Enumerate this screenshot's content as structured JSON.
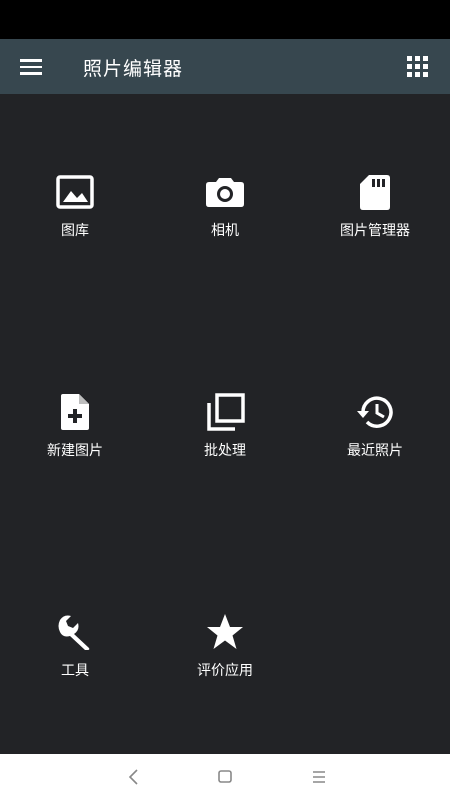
{
  "app_bar": {
    "title": "照片编辑器",
    "menu_icon": "hamburger-menu-icon",
    "apps_icon": "grid-apps-icon",
    "color": "#37474f"
  },
  "tiles": [
    {
      "label": "图库",
      "icon": "gallery-image-icon"
    },
    {
      "label": "相机",
      "icon": "camera-icon"
    },
    {
      "label": "图片管理器",
      "icon": "sd-card-icon"
    },
    {
      "label": "新建图片",
      "icon": "new-document-icon"
    },
    {
      "label": "批处理",
      "icon": "batch-layers-icon"
    },
    {
      "label": "最近照片",
      "icon": "history-icon"
    },
    {
      "label": "工具",
      "icon": "wrench-icon"
    },
    {
      "label": "评价应用",
      "icon": "star-icon"
    }
  ],
  "nav_bar": {
    "back_icon": "back-chevron-icon",
    "home_icon": "home-square-icon",
    "recents_icon": "recents-menu-icon"
  },
  "colors": {
    "background": "#222326",
    "status_bar": "#000000",
    "nav_bar": "#ffffff"
  }
}
